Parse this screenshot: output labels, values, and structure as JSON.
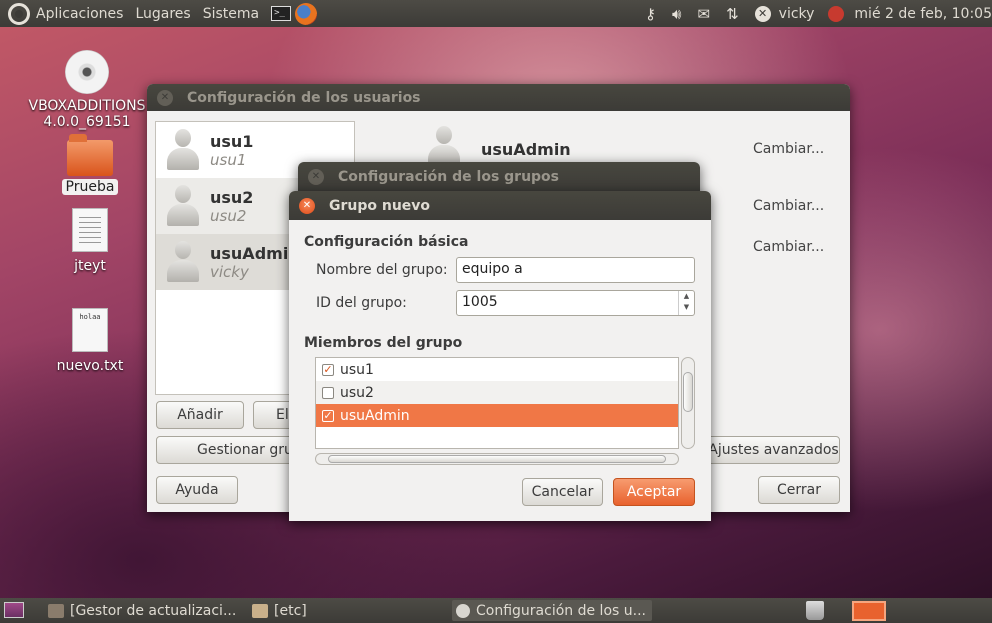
{
  "top_panel": {
    "menus": [
      "Aplicaciones",
      "Lugares",
      "Sistema"
    ],
    "user": "vicky",
    "clock": "mié  2 de feb, 10:05"
  },
  "desktop": {
    "icons": [
      {
        "label_line1": "VBOXADDITIONS",
        "label_line2": "4.0.0_69151"
      },
      {
        "label": "Prueba"
      },
      {
        "label": "jteyt"
      },
      {
        "label": "nuevo.txt",
        "preview_text": "holaa"
      }
    ]
  },
  "users_window": {
    "title": "Configuración de los usuarios",
    "users": [
      {
        "name": "usu1",
        "sub": "usu1"
      },
      {
        "name": "usu2",
        "sub": "usu2"
      },
      {
        "name": "usuAdmin",
        "sub": "vicky"
      }
    ],
    "detail_name": "usuAdmin",
    "change_labels": [
      "Cambiar...",
      "Cambiar...",
      "Cambiar..."
    ],
    "add_button": "Añadir",
    "delete_button": "El",
    "manage_groups_button": "Gestionar gru",
    "advanced_button": "Ajustes avanzados",
    "help_button": "Ayuda",
    "close_button": "Cerrar"
  },
  "groups_window": {
    "title": "Configuración de los grupos"
  },
  "new_group_dialog": {
    "title": "Grupo nuevo",
    "basic_section": "Configuración básica",
    "name_label": "Nombre del grupo:",
    "name_value": "equipo a",
    "id_label": "ID del grupo:",
    "id_value": "1005",
    "members_section": "Miembros del grupo",
    "members": [
      {
        "name": "usu1",
        "checked": true
      },
      {
        "name": "usu2",
        "checked": false
      },
      {
        "name": "usuAdmin",
        "checked": true
      }
    ],
    "cancel_button": "Cancelar",
    "accept_button": "Aceptar"
  },
  "bottom_panel": {
    "tasks": [
      "[Gestor de actualizaci...",
      "[etc]",
      "Configuración de los u..."
    ]
  },
  "colors": {
    "accent": "#f07746",
    "panel": "#3c3b37",
    "window_bg": "#f2f1f0"
  }
}
